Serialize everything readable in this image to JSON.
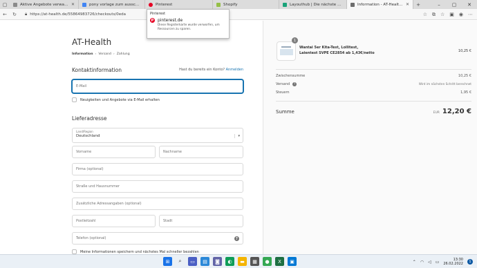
{
  "tabs": [
    {
      "label": "Aktive Angebote verwalten",
      "color": "#8a8a8a"
    },
    {
      "label": "pony vorlage zum ausschneiden",
      "color": "#4285f4"
    },
    {
      "label": "Pinterest",
      "color": "#e60023"
    },
    {
      "label": "Shopify",
      "color": "#95bf47"
    },
    {
      "label": "Layouthub | Die nächste Gene...",
      "color": "#1aa37a"
    },
    {
      "label": "Information - AT-Health - Bez...",
      "color": "#6d6d6d"
    }
  ],
  "address": {
    "url": "https://at-health.de/55864983726/checkouts/0eda"
  },
  "popup": {
    "title": "Pinterest",
    "host": "pinterest.de",
    "message": "Diese Registerkarte wurde verworfen, um Ressourcen zu sparen."
  },
  "checkout": {
    "shop_name": "AT-Health",
    "breadcrumb": [
      "Information",
      "Versand",
      "Zahlung"
    ],
    "contact_title": "Kontaktinformation",
    "have_account": "Hast du bereits ein Konto?",
    "login_link": "Anmelden",
    "email_placeholder": "E-Mail",
    "newsletter_label": "Neuigkeiten und Angebote via E-Mail erhalten",
    "shipping_title": "Lieferadresse",
    "country_label": "Land/Region",
    "country_value": "Deutschland",
    "firstname_placeholder": "Vorname",
    "lastname_placeholder": "Nachname",
    "company_placeholder": "Firma (optional)",
    "street_placeholder": "Straße und Hausnummer",
    "address2_placeholder": "Zusätzliche Adressangaben (optional)",
    "zip_placeholder": "Postleitzahl",
    "city_placeholder": "Stadt",
    "phone_placeholder": "Telefon (optional)",
    "save_info_label": "Meine Informationen speichern und nächstes Mal schneller bezahlen"
  },
  "summary": {
    "product_qty": "1",
    "product_name": "Wantai 5er Kita-Test, Lollitest, Laientest SVPE CE2854 ab 1,43€/netto",
    "product_price": "10,25 €",
    "subtotal_label": "Zwischensumme",
    "subtotal_value": "10,25 €",
    "shipping_label": "Versand",
    "shipping_value": "Wird im nächsten Schritt berechnet",
    "tax_label": "Steuern",
    "tax_value": "1,95 €",
    "total_label": "Summe",
    "total_currency": "EUR",
    "total_value": "12,20 €"
  },
  "taskbar": {
    "time": "13:30",
    "date": "26.02.2022",
    "notifications": "1"
  }
}
